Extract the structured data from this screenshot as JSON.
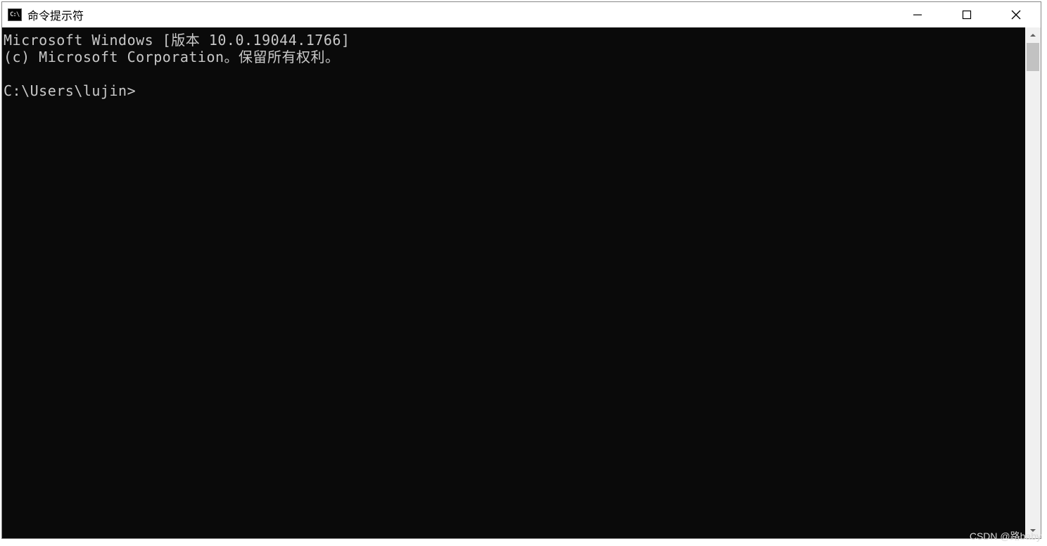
{
  "window": {
    "title": "命令提示符",
    "icon_label": "C:\\"
  },
  "console": {
    "lines": [
      "Microsoft Windows [版本 10.0.19044.1766]",
      "(c) Microsoft Corporation。保留所有权利。",
      "",
      "C:\\Users\\lujin>"
    ]
  },
  "watermark": "CSDN @路baby"
}
